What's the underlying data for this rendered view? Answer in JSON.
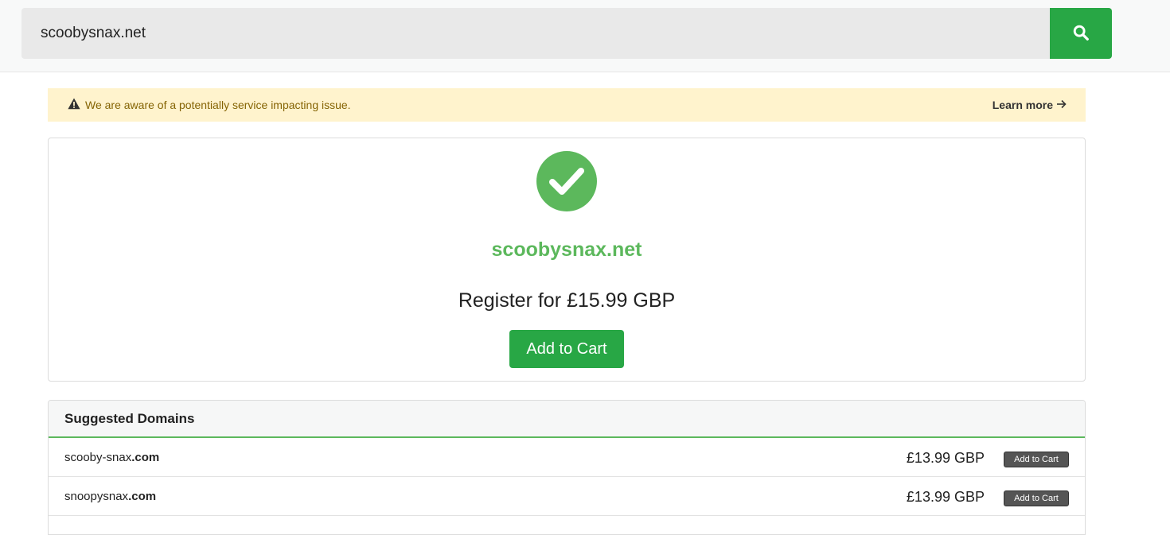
{
  "search": {
    "value": "scoobysnax.net",
    "button_icon": "search-icon"
  },
  "alert": {
    "icon": "warning-icon",
    "message": "We are aware of a potentially service impacting issue.",
    "link_label": "Learn more",
    "link_icon": "arrow-right-icon"
  },
  "result": {
    "icon": "check-circle-icon",
    "domain": "scoobysnax.net",
    "price_text": "Register for £15.99 GBP",
    "add_label": "Add to Cart"
  },
  "suggested": {
    "title": "Suggested Domains",
    "items": [
      {
        "name": "scooby-snax",
        "tld": ".com",
        "price": "£13.99 GBP",
        "add_label": "Add to Cart"
      },
      {
        "name": "snoopysnax",
        "tld": ".com",
        "price": "£13.99 GBP",
        "add_label": "Add to Cart"
      }
    ]
  },
  "colors": {
    "accent_green": "#28a745",
    "success_green": "#5cb85c",
    "alert_bg": "#fff3cd"
  }
}
